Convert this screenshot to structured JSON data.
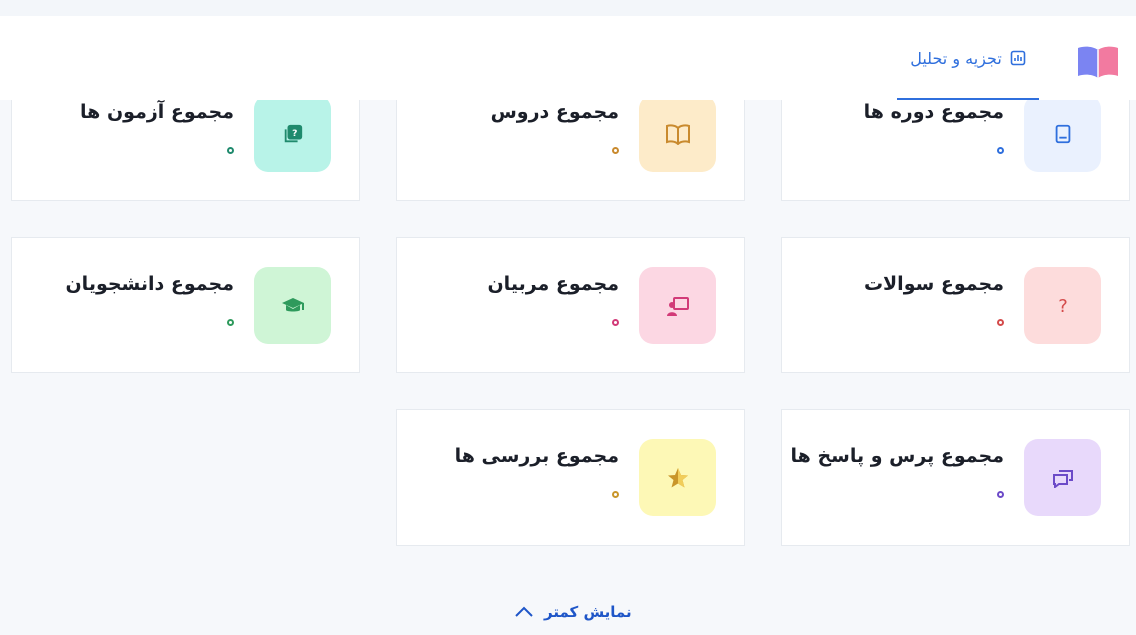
{
  "header": {
    "logo_icon": "book-logo-icon",
    "tabs": [
      {
        "label": "تجزیه و تحلیل",
        "icon": "bar-chart-icon",
        "active": true
      }
    ]
  },
  "cards": [
    {
      "title": "مجموع دوره ها",
      "icon": "book-icon",
      "tile_color": "#eaf1fe",
      "accent": "#2f6fdd"
    },
    {
      "title": "مجموع دروس",
      "icon": "open-book-icon",
      "tile_color": "#fdebc9",
      "accent": "#c98a2e"
    },
    {
      "title": "مجموع آزمون ها",
      "icon": "quiz-icon",
      "tile_color": "#b8f3e8",
      "accent": "#1f8a6d"
    },
    {
      "title": "مجموع سوالات",
      "icon": "question-icon",
      "tile_color": "#fddcdc",
      "accent": "#d44b4b"
    },
    {
      "title": "مجموع مربیان",
      "icon": "teacher-icon",
      "tile_color": "#fcd7e3",
      "accent": "#d23a78"
    },
    {
      "title": "مجموع دانشجویان",
      "icon": "graduation-cap-icon",
      "tile_color": "#cff5d6",
      "accent": "#2e9a5c"
    },
    {
      "title": "مجموع پرس و پاسخ ها",
      "icon": "chat-icon",
      "tile_color": "#e8d9fb",
      "accent": "#6c4ac8"
    },
    {
      "title": "مجموع بررسی ها",
      "icon": "star-icon",
      "tile_color": "#fdf8b6",
      "accent": "#c9962a"
    }
  ],
  "footer": {
    "toggle_label": "نمایش کمتر",
    "toggle_icon": "chevron-up-icon"
  },
  "colors": {
    "primary": "#2f6fdd",
    "background": "#f6f8fb"
  }
}
